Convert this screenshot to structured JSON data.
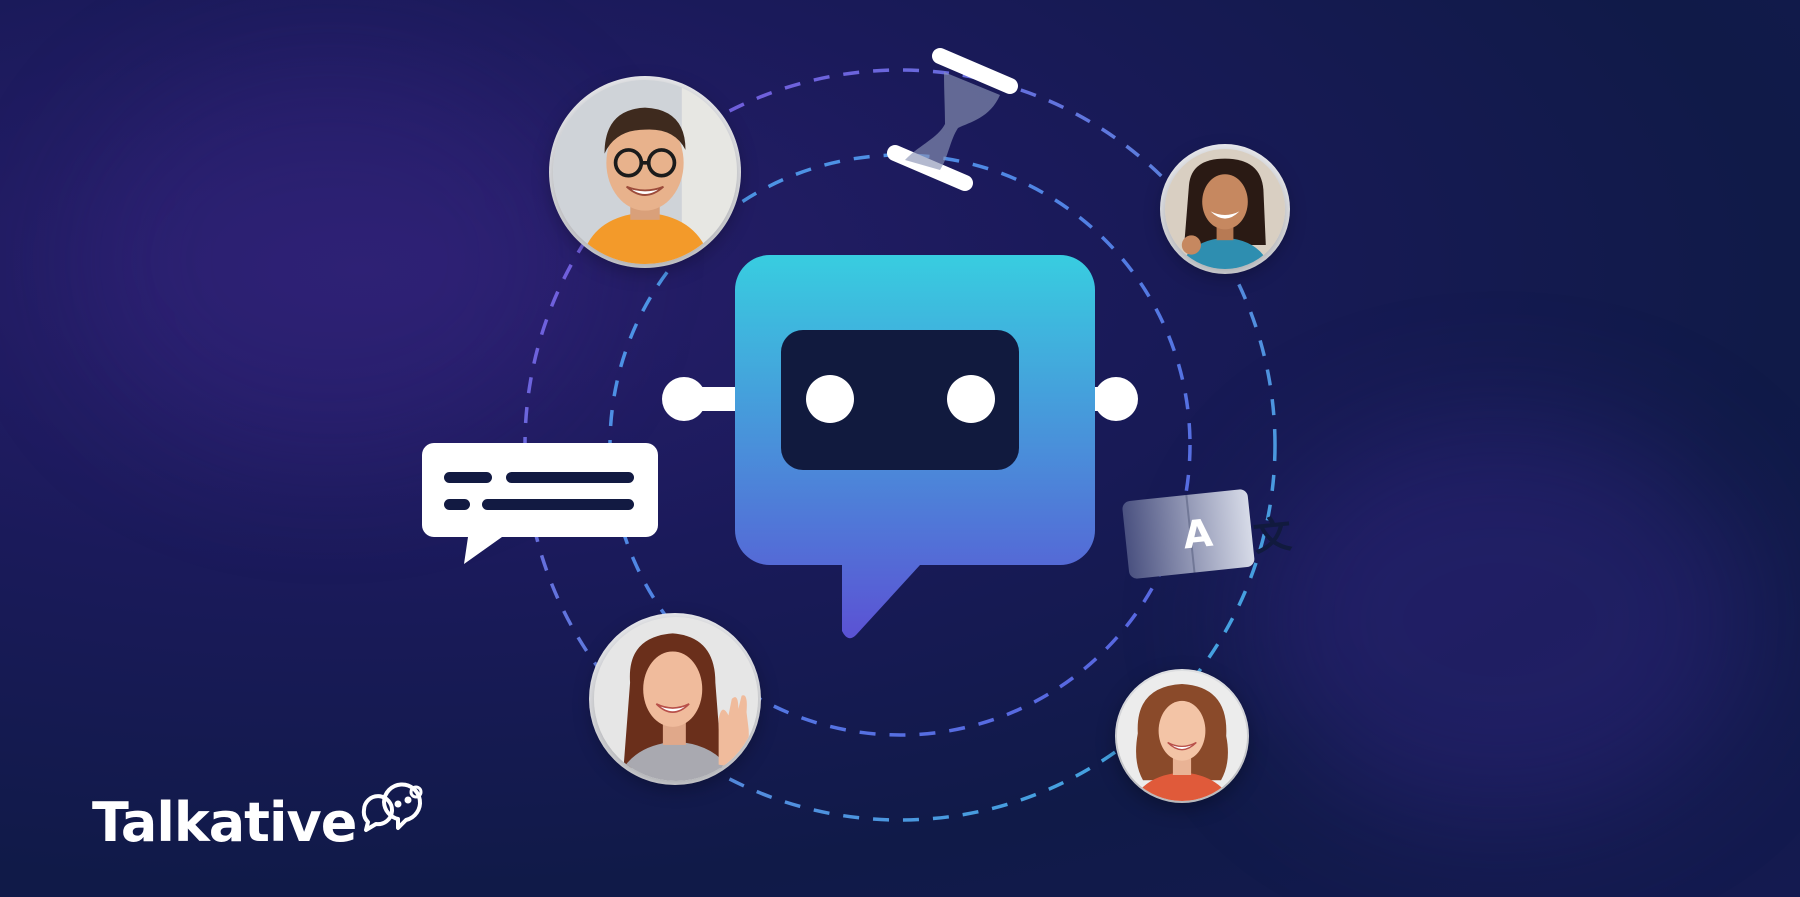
{
  "brand": {
    "name": "Talkative",
    "logo_icon": "speech-bubbles-logo-icon"
  },
  "icons": {
    "bot": "chatbot-icon",
    "chat": "chat-bubble-icon",
    "hourglass": "hourglass-icon",
    "translate": "translate-icon"
  },
  "translate_icon": {
    "left_glyph": "A",
    "right_glyph": "文"
  },
  "colors": {
    "background": "#141a50",
    "bot_gradient_top": "#36c9e0",
    "bot_gradient_bottom": "#5a55d6",
    "orbit_outer": "#7b5be0",
    "orbit_inner": "#3fb5e0",
    "white": "#ffffff"
  }
}
